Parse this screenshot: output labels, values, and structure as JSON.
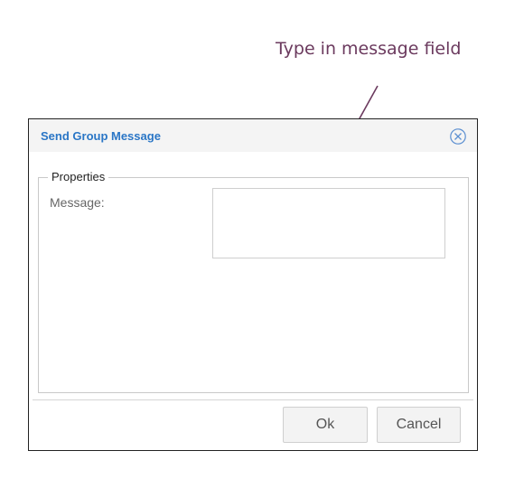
{
  "annotation": {
    "text": "Type in message field"
  },
  "dialog": {
    "title": "Send Group Message",
    "close_icon": "close-circle-icon",
    "fieldset_legend": "Properties",
    "message_label": "Message:",
    "message_value": "",
    "ok_label": "Ok",
    "cancel_label": "Cancel"
  },
  "colors": {
    "title": "#2a76c6",
    "annotation": "#6b3a5e"
  }
}
